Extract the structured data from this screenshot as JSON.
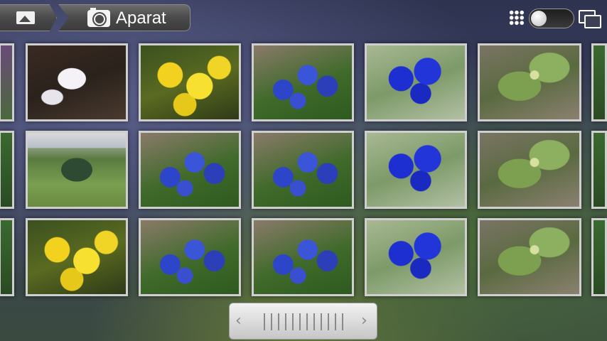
{
  "header": {
    "home_icon": "gallery-icon",
    "current_icon": "camera-icon",
    "current_title": "Aparat",
    "right_icons": [
      "grid-view-icon",
      "view-toggle-switch",
      "slideshow-icon"
    ]
  },
  "grid": {
    "rows": [
      [
        "partial-purple",
        "magnolia",
        "yellow-flowers",
        "grape-hyacinth",
        "blue-primrose",
        "rhododendron-leaves",
        "partial-green"
      ],
      [
        "partial-green",
        "garden",
        "grape-hyacinth",
        "grape-hyacinth",
        "blue-primrose",
        "rhododendron-leaves",
        "partial-green"
      ],
      [
        "partial-green",
        "yellow-flowers",
        "grape-hyacinth",
        "grape-hyacinth",
        "blue-primrose",
        "rhododendron-leaves",
        "partial-green"
      ]
    ]
  },
  "scrubber": {
    "left_arrow": "‹",
    "right_arrow": "›"
  },
  "colors": {
    "toolbar_bg": "#4a4a4a",
    "thumb_border": "#cfcfcf",
    "scrubber_bg": "#d8d8d8"
  }
}
